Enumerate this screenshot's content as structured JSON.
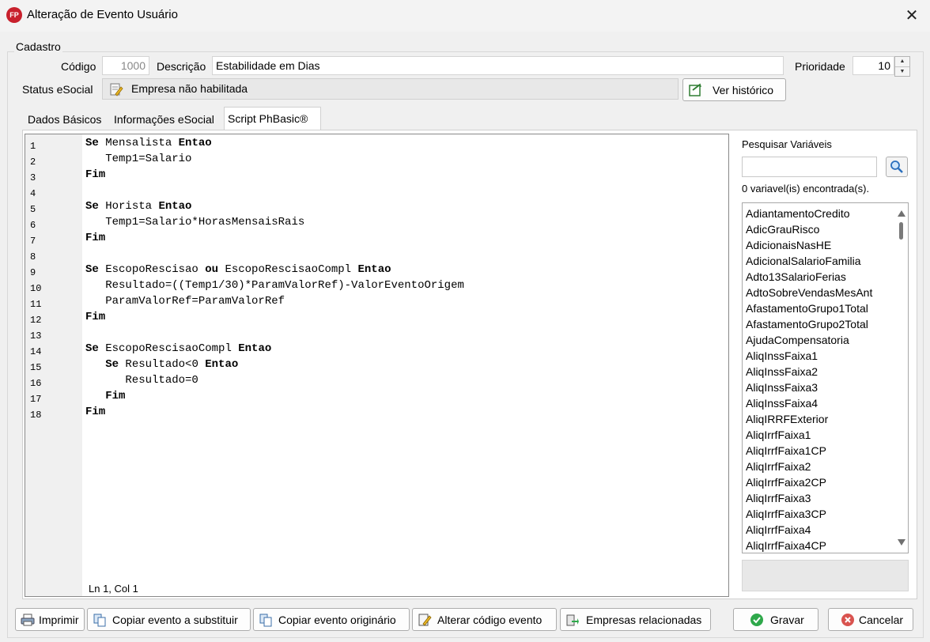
{
  "window": {
    "title": "Alteração de Evento Usuário",
    "logo": "FP"
  },
  "cadastro": {
    "group_label": "Cadastro",
    "codigo_label": "Código",
    "codigo_value": "1000",
    "descricao_label": "Descrição",
    "descricao_value": "Estabilidade em Dias",
    "prioridade_label": "Prioridade",
    "prioridade_value": "10",
    "status_label": "Status eSocial",
    "status_value": "Empresa não habilitada",
    "ver_historico": "Ver histórico"
  },
  "tabs": [
    {
      "label": "Dados Básicos"
    },
    {
      "label": "Informações eSocial"
    },
    {
      "label": "Script PhBasic®"
    }
  ],
  "editor": {
    "line_numbers": [
      "1",
      "2",
      "3",
      "4",
      "5",
      "6",
      "7",
      "8",
      "9",
      "10",
      "11",
      "12",
      "13",
      "14",
      "15",
      "16",
      "17",
      "18"
    ],
    "lines": [
      [
        {
          "k": "Se"
        },
        {
          "t": " Mensalista "
        },
        {
          "k": "Entao"
        }
      ],
      [
        {
          "t": "   Temp1=Salario"
        }
      ],
      [
        {
          "k": "Fim"
        }
      ],
      [],
      [
        {
          "k": "Se"
        },
        {
          "t": " Horista "
        },
        {
          "k": "Entao"
        }
      ],
      [
        {
          "t": "   Temp1=Salario*HorasMensaisRais"
        }
      ],
      [
        {
          "k": "Fim"
        }
      ],
      [],
      [
        {
          "k": "Se"
        },
        {
          "t": " EscopoRescisao "
        },
        {
          "k": "ou"
        },
        {
          "t": " EscopoRescisaoCompl "
        },
        {
          "k": "Entao"
        }
      ],
      [
        {
          "t": "   Resultado=((Temp1/30)*ParamValorRef)-ValorEventoOrigem"
        }
      ],
      [
        {
          "t": "   ParamValorRef=ParamValorRef"
        }
      ],
      [
        {
          "k": "Fim"
        }
      ],
      [],
      [
        {
          "k": "Se"
        },
        {
          "t": " EscopoRescisaoCompl "
        },
        {
          "k": "Entao"
        }
      ],
      [
        {
          "t": "   "
        },
        {
          "k": "Se"
        },
        {
          "t": " Resultado<0 "
        },
        {
          "k": "Entao"
        }
      ],
      [
        {
          "t": "      Resultado=0"
        }
      ],
      [
        {
          "t": "   "
        },
        {
          "k": "Fim"
        }
      ],
      [
        {
          "k": "Fim"
        }
      ]
    ],
    "caret_position": "Ln 1, Col 1"
  },
  "variables": {
    "title": "Pesquisar Variáveis",
    "search_value": "",
    "count_text": "0 variavel(is) encontrada(s).",
    "items": [
      "AdiantamentoCredito",
      "AdicGrauRisco",
      "AdicionaisNasHE",
      "AdicionalSalarioFamilia",
      "Adto13SalarioFerias",
      "AdtoSobreVendasMesAnt",
      "AfastamentoGrupo1Total",
      "AfastamentoGrupo2Total",
      "AjudaCompensatoria",
      "AliqInssFaixa1",
      "AliqInssFaixa2",
      "AliqInssFaixa3",
      "AliqInssFaixa4",
      "AliqIRRFExterior",
      "AliqIrrfFaixa1",
      "AliqIrrfFaixa1CP",
      "AliqIrrfFaixa2",
      "AliqIrrfFaixa2CP",
      "AliqIrrfFaixa3",
      "AliqIrrfFaixa3CP",
      "AliqIrrfFaixa4",
      "AliqIrrfFaixa4CP"
    ]
  },
  "footer": {
    "imprimir": "Imprimir",
    "copiar_substituir": "Copiar evento a substituir",
    "copiar_originario": "Copiar evento originário",
    "alterar_codigo": "Alterar código evento",
    "empresas_relacionadas": "Empresas relacionadas",
    "gravar": "Gravar",
    "cancelar": "Cancelar"
  },
  "colors": {
    "accent_red": "#c8202c",
    "gravar_green": "#2ea84a",
    "cancel_red": "#d9534f"
  }
}
